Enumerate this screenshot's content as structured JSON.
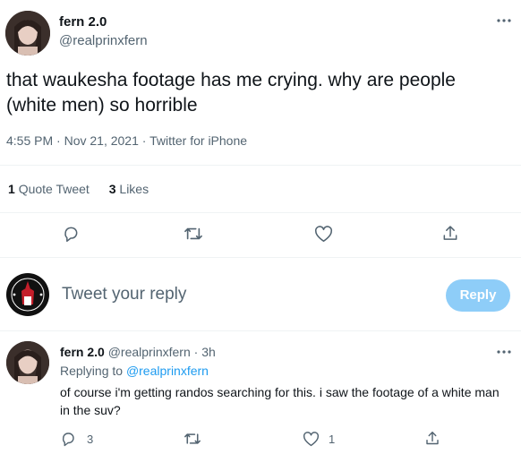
{
  "main_tweet": {
    "display_name": "fern 2.0",
    "handle": "@realprinxfern",
    "text": "that waukesha footage has me crying. why are people (white men) so horrible",
    "meta": {
      "time": "4:55 PM",
      "date": "Nov 21, 2021",
      "source": "Twitter for iPhone"
    },
    "stats": {
      "quote_count": "1",
      "quote_label": "Quote Tweet",
      "like_count": "3",
      "like_label": "Likes"
    }
  },
  "reply_box": {
    "placeholder": "Tweet your reply",
    "button_label": "Reply"
  },
  "reply_tweet": {
    "display_name": "fern 2.0",
    "handle": "@realprinxfern",
    "time": "3h",
    "replying_to_label": "Replying to",
    "replying_to_handle": "@realprinxfern",
    "text": "of course i'm getting randos searching for this. i saw the footage of a white man in the suv?",
    "reply_count": "3",
    "like_count": "1"
  },
  "icons": {
    "more": "more-horizontal-icon",
    "reply": "reply-icon",
    "retweet": "retweet-icon",
    "like": "heart-icon",
    "share": "share-icon"
  },
  "colors": {
    "accent": "#1d9bf0",
    "reply_button_disabled": "#8ecdf8",
    "muted_text": "#536471",
    "divider": "#eff3f4"
  }
}
